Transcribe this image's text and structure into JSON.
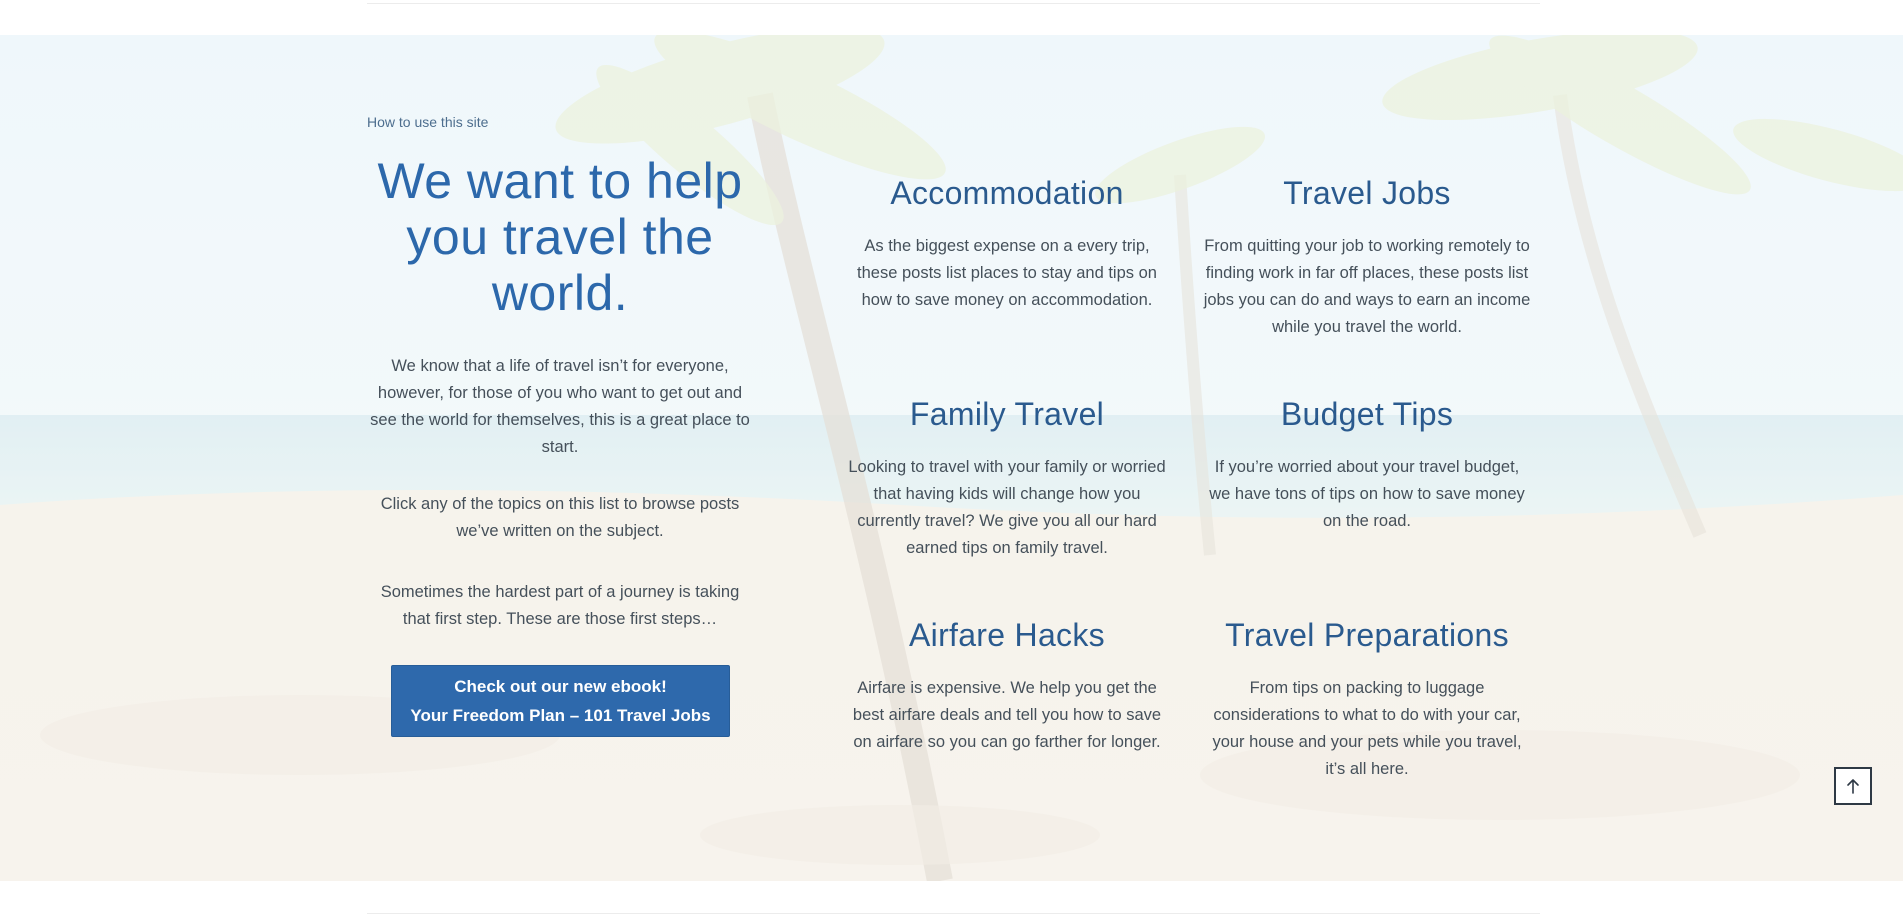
{
  "section": {
    "eyebrow": "How to use this site",
    "headline": "We want to help you travel the world.",
    "paragraphs": [
      "We know that a life of travel isn’t for everyone, however, for those of you who want to get out and see the world for themselves, this is a great place to start.",
      "Click any of the topics on this list to browse posts we’ve written on the subject.",
      "Sometimes the hardest part of a journey is taking that first step. These are those first steps…"
    ],
    "cta": {
      "line1": "Check out our new ebook!",
      "line2": "Your Freedom Plan – 101 Travel Jobs"
    }
  },
  "topics": [
    {
      "title": "Accommodation",
      "description": "As the biggest expense on a every trip, these posts list places to stay and tips on how to save money on accommodation."
    },
    {
      "title": "Travel Jobs",
      "description": "From quitting your job to working remotely to finding work in far off places, these posts list jobs you can do and ways to earn an income while you travel the world."
    },
    {
      "title": "Family Travel",
      "description": "Looking to travel with your family or worried that having kids will change how you currently travel? We give you all our hard earned tips on family travel."
    },
    {
      "title": "Budget Tips",
      "description": "If you’re worried about your travel budget, we have tons of tips on how to save money on the road."
    },
    {
      "title": "Airfare Hacks",
      "description": "Airfare is expensive. We help you get the best airfare deals and tell you how to save on airfare so you can go farther for longer."
    },
    {
      "title": "Travel Preparations",
      "description": "From tips on packing to luggage considerations to what to do with your car, your house and your pets while you travel, it’s all here."
    }
  ],
  "back_to_top": {
    "icon": "arrow-up-icon"
  },
  "colors": {
    "heading_blue": "#2c68ab",
    "topic_title": "#2a5a8e",
    "body_text": "#45505a",
    "button_bg": "#2e69ac"
  }
}
